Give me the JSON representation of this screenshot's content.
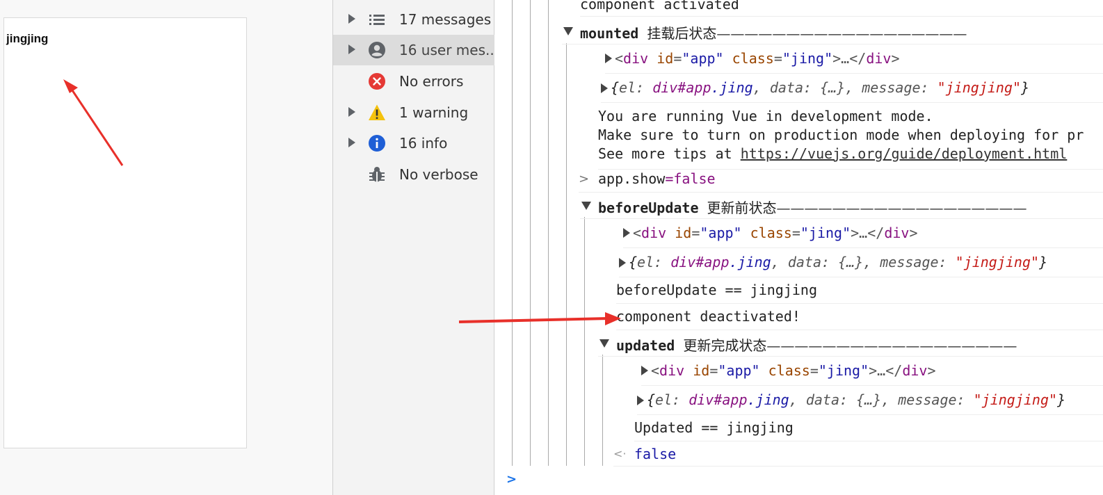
{
  "page": {
    "text": "jingjing"
  },
  "sidebar": {
    "items": [
      {
        "label": "17 messages",
        "icon": "list-icon"
      },
      {
        "label": "16 user mes...",
        "icon": "user-circle-icon"
      },
      {
        "label": "No errors",
        "icon": "error-icon"
      },
      {
        "label": "1 warning",
        "icon": "warning-icon"
      },
      {
        "label": "16 info",
        "icon": "info-icon"
      },
      {
        "label": "No verbose",
        "icon": "bug-icon"
      }
    ]
  },
  "log": {
    "component_activated": "component activated",
    "mounted": {
      "name": "mounted",
      "cn": "挂载后状态",
      "dashes": "——————————————————"
    },
    "div_open": "<",
    "div_tag": "div",
    "id_attr": "id",
    "id_val": "\"app\"",
    "class_attr": "class",
    "class_val": "\"jing\"",
    "div_rest": ">…</",
    "div_close": "div",
    "div_end": ">",
    "eq": "=",
    "obj_open": "{",
    "el_key": "el: ",
    "el_val": "div#app",
    "el_cls": ".jing",
    "data_key": ", data: ",
    "data_val": "{…}",
    "msg_key": ", message: ",
    "msg_val": "\"jingjing\"",
    "obj_close": "}",
    "vue_dev_1": "You are running Vue in development mode.",
    "vue_dev_2": "Make sure to turn on production mode when deploying for pr",
    "vue_dev_3_prefix": "See more tips at ",
    "vue_dev_3_link": "https://vuejs.org/guide/deployment.html",
    "input_cmd_a": "app.show",
    "input_cmd_eq": "=",
    "input_cmd_b": "false",
    "beforeUpdate": {
      "name": "beforeUpdate",
      "cn": "更新前状态",
      "dashes": "——————————————————"
    },
    "before_update_eq": "beforeUpdate == jingjing",
    "component_deactivated": "component deactivated!",
    "updated": {
      "name": "updated",
      "cn": "更新完成状态",
      "dashes": "——————————————————"
    },
    "updated_eq": "Updated == jingjing",
    "result": "false",
    "result_chevron": "<·",
    "input_chevron": ">",
    "prompt_chevron": ">"
  },
  "colors": {
    "arrow": "#e8302a",
    "tag": "#881280",
    "attr": "#994500",
    "string": "#c41a16",
    "value": "#1a1aa6"
  }
}
